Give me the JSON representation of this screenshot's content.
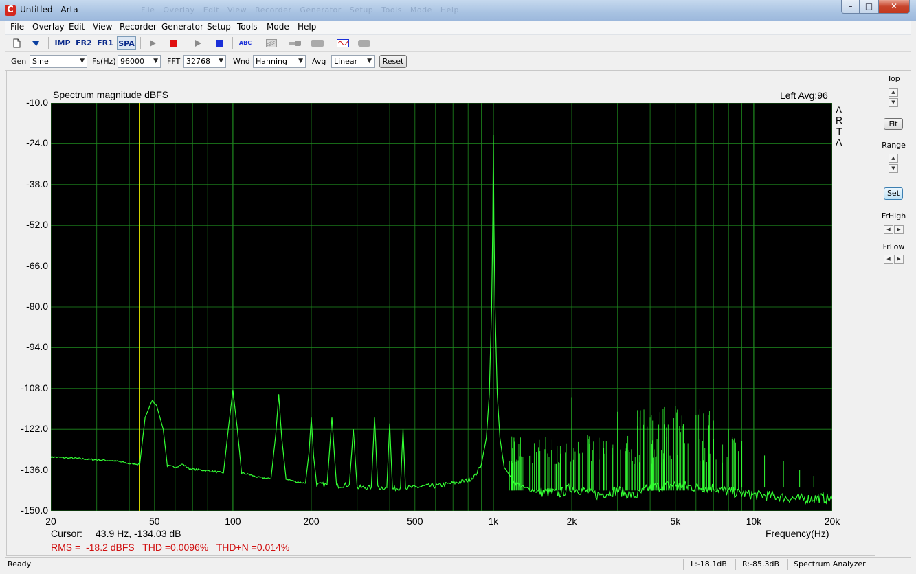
{
  "window": {
    "title": "Untitled - Arta",
    "app_icon_glyph": "C",
    "minimize": "–",
    "maximize": "□",
    "close": "✕"
  },
  "menu": [
    {
      "label": "File"
    },
    {
      "label": "Overlay"
    },
    {
      "label": "Edit"
    },
    {
      "label": "View"
    },
    {
      "label": "Recorder"
    },
    {
      "label": "Generator"
    },
    {
      "label": "Setup"
    },
    {
      "label": "Tools"
    },
    {
      "label": "Mode"
    },
    {
      "label": "Help"
    }
  ],
  "toolbar": {
    "imp": "IMP",
    "fr2": "FR2",
    "fr1": "FR1",
    "spa": "SPA",
    "abc": "ABC",
    "icons": [
      "new-file-icon",
      "open-icon",
      "play-icon",
      "stop-icon",
      "play-icon",
      "stop-icon",
      "abc-icon",
      "grid-icon",
      "probe-icon",
      "meter-icon",
      "wave-icon",
      "meter-icon"
    ]
  },
  "settings": {
    "gen_label": "Gen",
    "gen_value": "Sine",
    "fs_label": "Fs(Hz)",
    "fs_value": "96000",
    "fft_label": "FFT",
    "fft_value": "32768",
    "wnd_label": "Wnd",
    "wnd_value": "Hanning",
    "avg_label": "Avg",
    "avg_value": "Linear",
    "reset_label": "Reset"
  },
  "plot": {
    "title": "Spectrum magnitude dBFS",
    "channel_info": "Left  Avg:96",
    "watermark": [
      "A",
      "R",
      "T",
      "A"
    ],
    "cursor_label": "Cursor:",
    "cursor_value": "43.9 Hz, -134.03 dB",
    "stats": "RMS =  -18.2 dBFS   THD =0.0096%   THD+N =0.014%",
    "x_axis_label": "Frequency(Hz)",
    "colors": {
      "background": "#000000",
      "grid": "#1f8a1f",
      "trace": "#33ff33",
      "cursor": "#e8e800",
      "stats_text": "#d01010"
    }
  },
  "chart_data": {
    "type": "line",
    "title": "Spectrum magnitude dBFS",
    "xlabel": "Frequency(Hz)",
    "ylabel": "",
    "x_scale": "log",
    "xlim": [
      20,
      20000
    ],
    "ylim": [
      -150,
      -10
    ],
    "grid": true,
    "x_ticks": [
      {
        "v": 20,
        "label": "20"
      },
      {
        "v": 50,
        "label": "50"
      },
      {
        "v": 100,
        "label": "100"
      },
      {
        "v": 200,
        "label": "200"
      },
      {
        "v": 500,
        "label": "500"
      },
      {
        "v": 1000,
        "label": "1k"
      },
      {
        "v": 2000,
        "label": "2k"
      },
      {
        "v": 5000,
        "label": "5k"
      },
      {
        "v": 10000,
        "label": "10k"
      },
      {
        "v": 20000,
        "label": "20k"
      }
    ],
    "y_ticks": [
      {
        "v": -10,
        "label": "-10.0"
      },
      {
        "v": -24,
        "label": "-24.0"
      },
      {
        "v": -38,
        "label": "-38.0"
      },
      {
        "v": -52,
        "label": "-52.0"
      },
      {
        "v": -66,
        "label": "-66.0"
      },
      {
        "v": -80,
        "label": "-80.0"
      },
      {
        "v": -94,
        "label": "-94.0"
      },
      {
        "v": -108,
        "label": "-108.0"
      },
      {
        "v": -122,
        "label": "-122.0"
      },
      {
        "v": -136,
        "label": "-136.0"
      },
      {
        "v": -150,
        "label": "-150.0"
      }
    ],
    "cursor_x": 43.9,
    "series": [
      {
        "values": [
          [
            20,
            -131.5
          ],
          [
            25,
            -132
          ],
          [
            30,
            -132.5
          ],
          [
            35,
            -132.8
          ],
          [
            40,
            -133.8
          ],
          [
            43.9,
            -134.0
          ],
          [
            46,
            -118
          ],
          [
            49,
            -112
          ],
          [
            51,
            -114
          ],
          [
            54,
            -122
          ],
          [
            56,
            -134.5
          ],
          [
            60,
            -135
          ],
          [
            64,
            -134
          ],
          [
            68,
            -135.5
          ],
          [
            75,
            -136
          ],
          [
            85,
            -136.5
          ],
          [
            92,
            -137
          ],
          [
            96,
            -122
          ],
          [
            100,
            -108.5
          ],
          [
            104,
            -122
          ],
          [
            108,
            -137
          ],
          [
            115,
            -137.5
          ],
          [
            125,
            -138.5
          ],
          [
            140,
            -139
          ],
          [
            146,
            -124
          ],
          [
            150,
            -110
          ],
          [
            154,
            -125
          ],
          [
            160,
            -139
          ],
          [
            175,
            -140
          ],
          [
            190,
            -140.5
          ],
          [
            196,
            -130
          ],
          [
            200,
            -118
          ],
          [
            204,
            -131
          ],
          [
            210,
            -141
          ],
          [
            230,
            -141
          ],
          [
            240,
            -118
          ],
          [
            250,
            -141.5
          ],
          [
            280,
            -141
          ],
          [
            290,
            -122
          ],
          [
            300,
            -142
          ],
          [
            340,
            -142
          ],
          [
            350,
            -118
          ],
          [
            360,
            -142
          ],
          [
            390,
            -142
          ],
          [
            400,
            -120
          ],
          [
            410,
            -142.5
          ],
          [
            440,
            -142
          ],
          [
            450,
            -122
          ],
          [
            460,
            -142
          ],
          [
            500,
            -142
          ],
          [
            550,
            -141.5
          ],
          [
            600,
            -141.5
          ],
          [
            650,
            -141
          ],
          [
            700,
            -140.5
          ],
          [
            750,
            -140
          ],
          [
            800,
            -139.5
          ],
          [
            850,
            -138
          ],
          [
            900,
            -134
          ],
          [
            940,
            -125
          ],
          [
            965,
            -110
          ],
          [
            985,
            -80
          ],
          [
            995,
            -50
          ],
          [
            1000,
            -21
          ],
          [
            1005,
            -50
          ],
          [
            1015,
            -80
          ],
          [
            1035,
            -110
          ],
          [
            1060,
            -125
          ],
          [
            1100,
            -135
          ],
          [
            1200,
            -140
          ],
          [
            1300,
            -142
          ],
          [
            1500,
            -143.5
          ],
          [
            1800,
            -144
          ],
          [
            2000,
            -142
          ],
          [
            2500,
            -144.5
          ],
          [
            3000,
            -143
          ],
          [
            3500,
            -145
          ],
          [
            4000,
            -142
          ],
          [
            5000,
            -141
          ],
          [
            6000,
            -142
          ],
          [
            7000,
            -142
          ],
          [
            8000,
            -143.5
          ],
          [
            10000,
            -144.5
          ],
          [
            12000,
            -145
          ],
          [
            15000,
            -146
          ],
          [
            18000,
            -145.5
          ],
          [
            20000,
            -146
          ]
        ]
      }
    ],
    "harmonic_spikes": [
      [
        2000,
        -111
      ],
      [
        3000,
        -116
      ],
      [
        4000,
        -118
      ],
      [
        5000,
        -114
      ],
      [
        6000,
        -117
      ],
      [
        7000,
        -119
      ],
      [
        8000,
        -122
      ],
      [
        9000,
        -126
      ],
      [
        11000,
        -131
      ],
      [
        13000,
        -133
      ],
      [
        15000,
        -136
      ],
      [
        17000,
        -138
      ]
    ]
  },
  "right_panel": {
    "top_label": "Top",
    "fit_label": "Fit",
    "range_label": "Range",
    "set_label": "Set",
    "frhigh_label": "FrHigh",
    "frlow_label": "FrLow"
  },
  "status": {
    "ready": "Ready",
    "left_level": "L:-18.1dB",
    "right_level": "R:-85.3dB",
    "mode": "Spectrum Analyzer"
  }
}
